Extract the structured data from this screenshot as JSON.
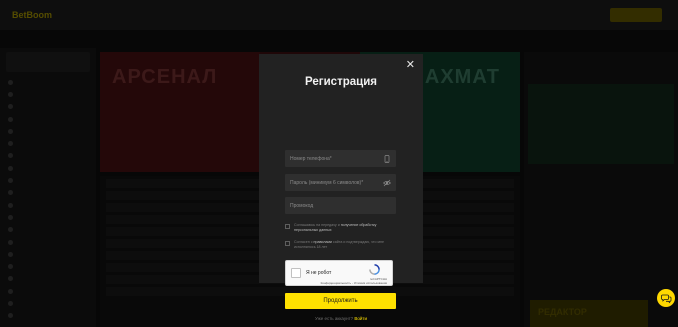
{
  "modal": {
    "title": "Регистрация",
    "phone_placeholder": "Номер телефона*",
    "password_placeholder": "Пароль (минимум 6 символов)*",
    "promo_placeholder": "Промокод",
    "consent_text_a": "Соглашаюсь на передачу и ",
    "consent_link_a": "получение обработку персональных данных",
    "consent_text_b": "Согласен с ",
    "consent_link_b": "правилами",
    "consent_text_b_rest": " сайта и подтверждаю, что мне исполнилось 18 лет",
    "captcha_label": "Я не робот",
    "captcha_brand": "reCAPTCHA",
    "captcha_links": "Конфиденциальность - Условия использования",
    "submit_label": "Продолжить",
    "have_account": "Уже есть аккаунт? ",
    "login_link": "Войти"
  },
  "background": {
    "logo": "BetBoom",
    "banner_team_left": "АРСЕНАЛ",
    "banner_team_right": "АХМАТ",
    "promo_text": "РЕДАКТОР"
  },
  "icons": {
    "close": "close-icon",
    "phone": "phone-icon",
    "password_visibility": "eye-icon",
    "captcha": "recaptcha-logo-icon",
    "chat": "chat-icon"
  },
  "colors": {
    "accent": "#ffe100",
    "modal_bg": "#222222",
    "field_bg": "#2f2f2f"
  }
}
